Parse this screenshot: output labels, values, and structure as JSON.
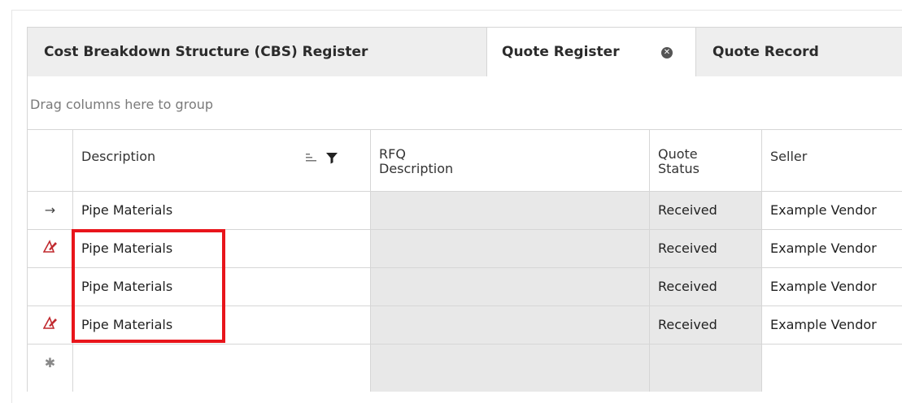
{
  "tabs": [
    {
      "label": "Cost Breakdown Structure (CBS) Register"
    },
    {
      "label": "Quote Register",
      "close_icon": "close-circle-icon",
      "active": true
    },
    {
      "label": "Quote Record"
    }
  ],
  "group_area": {
    "placeholder": "Drag columns here to group"
  },
  "columns": {
    "description": "Description",
    "rfq_line1": "RFQ",
    "rfq_line2": "Description",
    "status_line1": "Quote",
    "status_line2": "Status",
    "seller": "Seller",
    "description_icons": [
      "sort-ascending-icon",
      "filter-icon"
    ]
  },
  "rows": [
    {
      "indicator": "→",
      "indicator_icon": "current-row-arrow-icon",
      "description": "Pipe Materials",
      "rfq_description": "",
      "quote_status": "Received",
      "seller": "Example Vendor"
    },
    {
      "indicator_icon": "edit-pencil-icon",
      "description": "Pipe Materials",
      "rfq_description": "",
      "quote_status": "Received",
      "seller": "Example Vendor"
    },
    {
      "description": "Pipe Materials",
      "rfq_description": "",
      "quote_status": "Received",
      "seller": "Example Vendor"
    },
    {
      "indicator_icon": "edit-pencil-icon",
      "description": "Pipe Materials",
      "rfq_description": "",
      "quote_status": "Received",
      "seller": "Example Vendor"
    }
  ],
  "new_row": {
    "indicator": "✱",
    "indicator_icon": "new-row-asterisk-icon"
  },
  "colors": {
    "highlight": "#e8151b",
    "readonly_cell": "#e8e8e8",
    "edit_icon": "#c0282d"
  }
}
